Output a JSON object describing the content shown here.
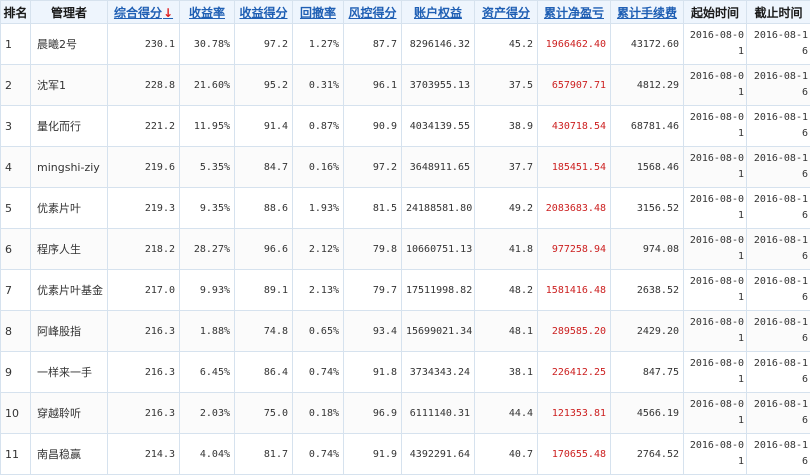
{
  "columns": [
    {
      "label": "排名",
      "arrow": ""
    },
    {
      "label": "管理者",
      "arrow": ""
    },
    {
      "label": "综合得分",
      "arrow": "↓"
    },
    {
      "label": "收益率",
      "arrow": ""
    },
    {
      "label": "收益得分",
      "arrow": ""
    },
    {
      "label": "回撤率",
      "arrow": ""
    },
    {
      "label": "风控得分",
      "arrow": ""
    },
    {
      "label": "账户权益",
      "arrow": ""
    },
    {
      "label": "资产得分",
      "arrow": ""
    },
    {
      "label": "累计净盈亏",
      "arrow": ""
    },
    {
      "label": "累计手续费",
      "arrow": ""
    },
    {
      "label": "起始时间",
      "arrow": ""
    },
    {
      "label": "截止时间",
      "arrow": ""
    }
  ],
  "rows": [
    {
      "rank": "1",
      "manager": "晨曦2号",
      "score": "230.1",
      "return_rate": "30.78%",
      "return_score": "97.2",
      "drawdown": "1.27%",
      "risk_score": "87.7",
      "equity": "8296146.32",
      "asset_score": "45.2",
      "net_pnl": "1966462.40",
      "fees": "43172.60",
      "start": "2016-08-01",
      "end": "2016-08-16"
    },
    {
      "rank": "2",
      "manager": "沈军1",
      "score": "228.8",
      "return_rate": "21.60%",
      "return_score": "95.2",
      "drawdown": "0.31%",
      "risk_score": "96.1",
      "equity": "3703955.13",
      "asset_score": "37.5",
      "net_pnl": "657907.71",
      "fees": "4812.29",
      "start": "2016-08-01",
      "end": "2016-08-16"
    },
    {
      "rank": "3",
      "manager": "量化而行",
      "score": "221.2",
      "return_rate": "11.95%",
      "return_score": "91.4",
      "drawdown": "0.87%",
      "risk_score": "90.9",
      "equity": "4034139.55",
      "asset_score": "38.9",
      "net_pnl": "430718.54",
      "fees": "68781.46",
      "start": "2016-08-01",
      "end": "2016-08-16"
    },
    {
      "rank": "4",
      "manager": "mingshi-ziy",
      "score": "219.6",
      "return_rate": "5.35%",
      "return_score": "84.7",
      "drawdown": "0.16%",
      "risk_score": "97.2",
      "equity": "3648911.65",
      "asset_score": "37.7",
      "net_pnl": "185451.54",
      "fees": "1568.46",
      "start": "2016-08-01",
      "end": "2016-08-16"
    },
    {
      "rank": "5",
      "manager": "优素片叶",
      "score": "219.3",
      "return_rate": "9.35%",
      "return_score": "88.6",
      "drawdown": "1.93%",
      "risk_score": "81.5",
      "equity": "24188581.80",
      "asset_score": "49.2",
      "net_pnl": "2083683.48",
      "fees": "3156.52",
      "start": "2016-08-01",
      "end": "2016-08-16"
    },
    {
      "rank": "6",
      "manager": "程序人生",
      "score": "218.2",
      "return_rate": "28.27%",
      "return_score": "96.6",
      "drawdown": "2.12%",
      "risk_score": "79.8",
      "equity": "10660751.13",
      "asset_score": "41.8",
      "net_pnl": "977258.94",
      "fees": "974.08",
      "start": "2016-08-01",
      "end": "2016-08-16"
    },
    {
      "rank": "7",
      "manager": "优素片叶基金",
      "score": "217.0",
      "return_rate": "9.93%",
      "return_score": "89.1",
      "drawdown": "2.13%",
      "risk_score": "79.7",
      "equity": "17511998.82",
      "asset_score": "48.2",
      "net_pnl": "1581416.48",
      "fees": "2638.52",
      "start": "2016-08-01",
      "end": "2016-08-16"
    },
    {
      "rank": "8",
      "manager": "阿峰股指",
      "score": "216.3",
      "return_rate": "1.88%",
      "return_score": "74.8",
      "drawdown": "0.65%",
      "risk_score": "93.4",
      "equity": "15699021.34",
      "asset_score": "48.1",
      "net_pnl": "289585.20",
      "fees": "2429.20",
      "start": "2016-08-01",
      "end": "2016-08-16"
    },
    {
      "rank": "9",
      "manager": "一样来一手",
      "score": "216.3",
      "return_rate": "6.45%",
      "return_score": "86.4",
      "drawdown": "0.74%",
      "risk_score": "91.8",
      "equity": "3734343.24",
      "asset_score": "38.1",
      "net_pnl": "226412.25",
      "fees": "847.75",
      "start": "2016-08-01",
      "end": "2016-08-16"
    },
    {
      "rank": "10",
      "manager": "穿越聆听",
      "score": "216.3",
      "return_rate": "2.03%",
      "return_score": "75.0",
      "drawdown": "0.18%",
      "risk_score": "96.9",
      "equity": "6111140.31",
      "asset_score": "44.4",
      "net_pnl": "121353.81",
      "fees": "4566.19",
      "start": "2016-08-01",
      "end": "2016-08-16"
    },
    {
      "rank": "11",
      "manager": "南昌稳赢",
      "score": "214.3",
      "return_rate": "4.04%",
      "return_score": "81.7",
      "drawdown": "0.74%",
      "risk_score": "91.9",
      "equity": "4392291.64",
      "asset_score": "40.7",
      "net_pnl": "170655.48",
      "fees": "2764.52",
      "start": "2016-08-01",
      "end": "2016-08-16"
    }
  ],
  "colors": {
    "link": "#1f5fb4",
    "arrow": "#e02020",
    "pnl": "#cc1f1f",
    "header_bg": "#eef5fd",
    "border": "#d6e2ee"
  }
}
